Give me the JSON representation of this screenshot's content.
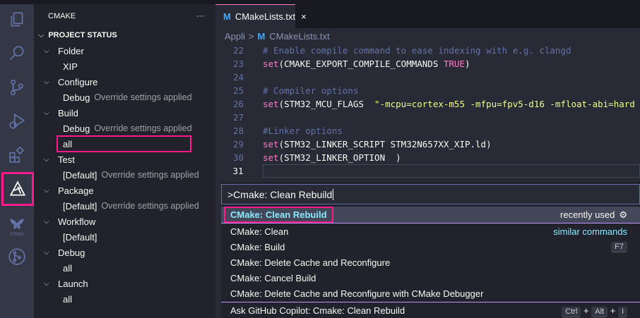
{
  "sidebar": {
    "title": "CMAKE",
    "more": "···",
    "section": "PROJECT STATUS",
    "tree": [
      {
        "label": "Folder",
        "children": [
          {
            "label": "XIP",
            "desc": ""
          }
        ]
      },
      {
        "label": "Configure",
        "children": [
          {
            "label": "Debug",
            "desc": "Override settings applied"
          }
        ]
      },
      {
        "label": "Build",
        "children": [
          {
            "label": "Debug",
            "desc": "Override settings applied"
          },
          {
            "label": "all",
            "desc": ""
          }
        ]
      },
      {
        "label": "Test",
        "children": [
          {
            "label": "[Default]",
            "desc": "Override settings applied"
          }
        ]
      },
      {
        "label": "Package",
        "children": [
          {
            "label": "[Default]",
            "desc": "Override settings applied"
          }
        ]
      },
      {
        "label": "Workflow",
        "children": [
          {
            "label": "[Default]",
            "desc": ""
          }
        ]
      },
      {
        "label": "Debug",
        "children": [
          {
            "label": "all",
            "desc": ""
          }
        ]
      },
      {
        "label": "Launch",
        "children": [
          {
            "label": "all",
            "desc": ""
          }
        ]
      }
    ]
  },
  "activity": {
    "stm_label": "STM32"
  },
  "editor": {
    "tab": "CMakeLists.txt",
    "tab_icon": "M",
    "close": "×",
    "breadcrumb": [
      "Appli",
      "CMakeLists.txt"
    ],
    "breadcrumb_sep": ">",
    "lines": [
      {
        "n": "22",
        "parts": [
          [
            "cm",
            "# Enable compile command to ease indexing with e.g. clangd"
          ]
        ]
      },
      {
        "n": "23",
        "parts": [
          [
            "kw",
            "set"
          ],
          [
            "",
            "(CMAKE_EXPORT_COMPILE_COMMANDS "
          ],
          [
            "kw",
            "TRUE"
          ],
          [
            "",
            ")"
          ]
        ]
      },
      {
        "n": "24",
        "parts": []
      },
      {
        "n": "25",
        "parts": [
          [
            "cm",
            "# Compiler options"
          ]
        ]
      },
      {
        "n": "26",
        "parts": [
          [
            "kw",
            "set"
          ],
          [
            "",
            "(STM32_MCU_FLAGS  "
          ],
          [
            "st",
            "\"-mcpu=cortex-m55 -mfpu=fpv5-d16 -mfloat-abi=hard"
          ]
        ]
      },
      {
        "n": "27",
        "parts": []
      },
      {
        "n": "28",
        "parts": [
          [
            "cm",
            "#Linker options"
          ]
        ]
      },
      {
        "n": "29",
        "parts": [
          [
            "kw",
            "set"
          ],
          [
            "",
            "(STM32_LINKER_SCRIPT STM32N657XX_XIP.ld)"
          ]
        ]
      },
      {
        "n": "30",
        "parts": [
          [
            "kw",
            "set"
          ],
          [
            "",
            "(STM32_LINKER_OPTION  )"
          ]
        ]
      },
      {
        "n": "31",
        "parts": []
      }
    ]
  },
  "quickpick": {
    "input": ">Cmake: Clean Rebuild",
    "items": [
      {
        "label": "CMake: Clean Rebuild",
        "right": "recently used"
      },
      {
        "label": "CMake: Clean",
        "right": "similar commands"
      },
      {
        "label": "CMake: Build",
        "key": "F7"
      },
      {
        "label": "CMake: Delete Cache and Reconfigure"
      },
      {
        "label": "CMake: Cancel Build"
      },
      {
        "label": "CMake: Delete Cache and Reconfigure with CMake Debugger"
      }
    ],
    "copilot": {
      "label": "Ask GitHub Copilot: Cmake: Clean Rebuild",
      "keys": [
        "Ctrl",
        "Alt",
        "I"
      ],
      "plus": "+"
    }
  }
}
